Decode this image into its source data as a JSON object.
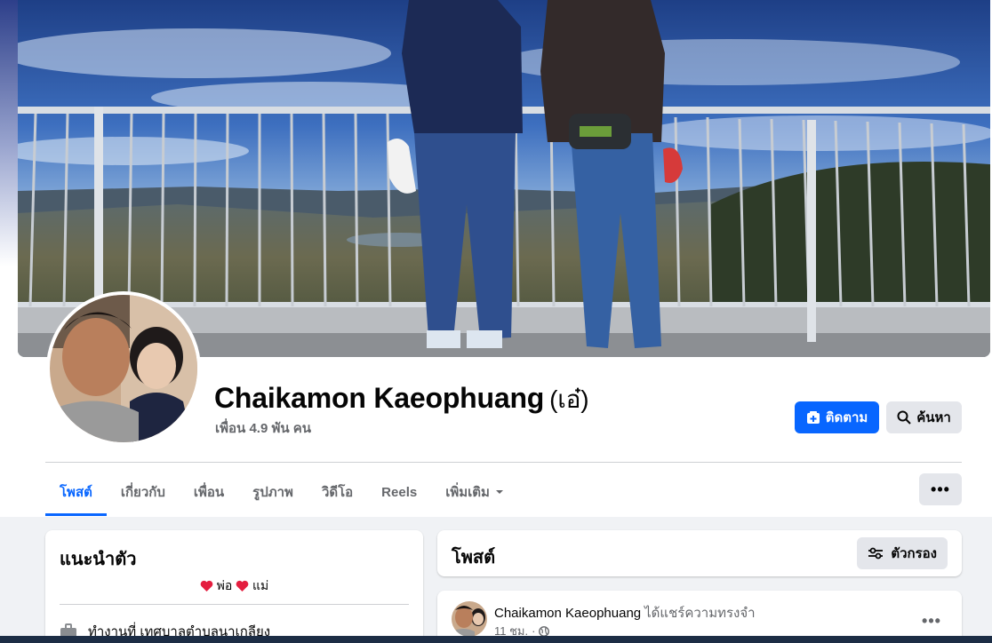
{
  "profile": {
    "name": "Chaikamon Kaeophuang",
    "nickname": "(เอ๋)",
    "friends": "เพื่อน 4.9 พัน คน"
  },
  "actions": {
    "follow_label": "ติดตาม",
    "search_label": "ค้นหา"
  },
  "tabs": [
    {
      "label": "โพสต์",
      "active": true
    },
    {
      "label": "เกี่ยวกับ"
    },
    {
      "label": "เพื่อน"
    },
    {
      "label": "รูปภาพ"
    },
    {
      "label": "วิดีโอ"
    },
    {
      "label": "Reels"
    },
    {
      "label": "เพิ่มเติม"
    }
  ],
  "intro": {
    "title": "แนะนำตัว",
    "bio_text": "พ่อ",
    "bio_text2": "แม่",
    "work": "ทำงานที่ เทศบาลตำบลนาเกลียง"
  },
  "posts": {
    "title": "โพสต์",
    "filter_label": "ตัวกรอง"
  },
  "post": {
    "author": "Chaikamon Kaeophuang",
    "action": "ได้แชร์ความทรงจำ",
    "time": "11 ชม.",
    "privacy": "·"
  },
  "colors": {
    "accent": "#0866ff",
    "heart": "#e41e3f"
  }
}
